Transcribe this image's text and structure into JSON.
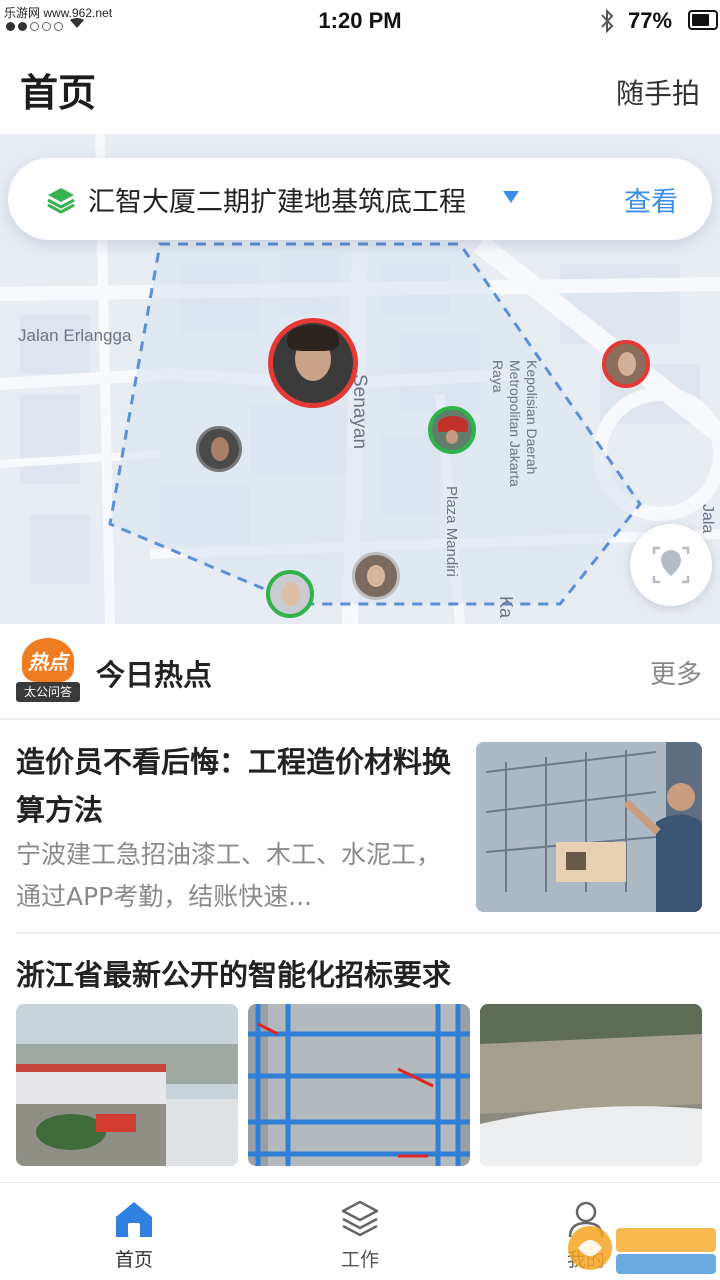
{
  "status_bar": {
    "site": "乐游网 www.962.net",
    "time": "1:20 PM",
    "battery": "77%",
    "battery_level": 0.77
  },
  "header": {
    "title": "首页",
    "action": "随手拍"
  },
  "map": {
    "project_name": "汇智大厦二期扩建地基筑底工程",
    "view_label": "查看",
    "labels": [
      "Jalan Erlangga",
      "Senayan",
      "Kepolisian Daerah Metropolitan Jakarta Raya",
      "Plaza Mandiri",
      "Ka",
      "Jala"
    ]
  },
  "hot": {
    "logo_text": "热点",
    "logo_sub": "太公问答",
    "title": "今日热点",
    "more_label": "更多"
  },
  "articles": [
    {
      "title": "造价员不看后悔：工程造价材料换算方法",
      "desc": "宁波建工急招油漆工、木工、水泥工，通过APP考勤，结账快速..."
    },
    {
      "title": "浙江省最新公开的智能化招标要求"
    }
  ],
  "tabs": [
    {
      "label": "首页",
      "icon": "home-icon"
    },
    {
      "label": "工作",
      "icon": "layers-icon"
    },
    {
      "label": "我的",
      "icon": "user-icon"
    }
  ],
  "watermark": "962.NET 乐游网",
  "colors": {
    "accent": "#3b8ee8",
    "map_bg": "#e6ecf3",
    "hot_orange": "#f07c22",
    "avatar_red": "#e53935",
    "avatar_green": "#2fb34a"
  }
}
